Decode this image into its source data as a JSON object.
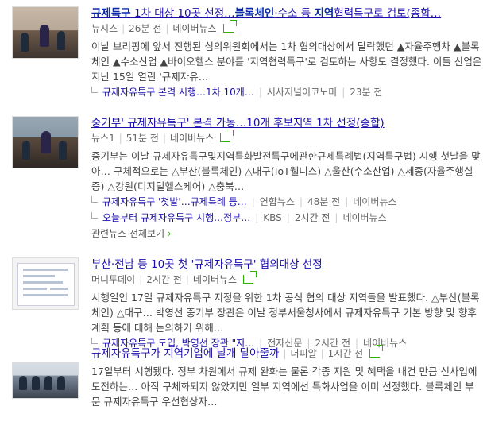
{
  "news": [
    {
      "title": "규제특구 1차 대상 10곳 선정…블록체인·수소 등 지역협력특구로 검토(종합…",
      "title_bold": [
        "규제특구",
        "블록체인",
        "지역"
      ],
      "meta": {
        "press": "뉴시스",
        "time": "26분 전",
        "portal": "네이버뉴스"
      },
      "desc": "이날 브리핑에 앞서 진행된 심의위원회에서는 1차 협의대상에서 탈락했던 ▲자율주행차 ▲블록체인 ▲수소산업 ▲바이오헬스 분야를 '지역협력특구'로 검토하는 사항도 결정했다. 이들 산업은 지난 15일 열린 '규제자유…",
      "related": [
        {
          "text": "규제자유특구 본격 시행…1차 10개…",
          "press": "시사저널이코노미",
          "time": "23분 전",
          "portal": ""
        }
      ]
    },
    {
      "title": "중기부' 규제자유특구' 본격 가동…10개 후보지역 1차 선정(종합)",
      "meta": {
        "press": "뉴스1",
        "time": "51분 전",
        "portal": "네이버뉴스"
      },
      "desc": "중기부는 이날 규제자유특구및지역특화발전특구에관한규제특례법(지역특구법) 시행 첫날을 맞아… 구체적으로는 △부산(블록체인) △대구(IoT웰니스) △울산(수소산업) △세종(자율주행실증) △강원(디지털헬스케어) △충북…",
      "related": [
        {
          "text": "규제자유특구 '첫발'…규제특례 등…",
          "press": "연합뉴스",
          "time": "48분 전",
          "portal": "네이버뉴스"
        },
        {
          "text": "오늘부터 규제자유특구 시행…정부…",
          "press": "KBS",
          "time": "2시간 전",
          "portal": "네이버뉴스"
        }
      ],
      "more": "관련뉴스 전체보기"
    },
    {
      "title": "부산·전남 등 10곳 첫 '규제자유특구' 협의대상 선정",
      "meta": {
        "press": "머니투데이",
        "time": "2시간 전",
        "portal": "네이버뉴스"
      },
      "desc": "시행일인 17일 규제자유특구 지정을 위한 1차 공식 협의 대상 지역들을 발표했다. △부산(블록체인) △대구… 박영선 중기부 장관은 이날 정부서울청사에서 규제자유특구 기본 방향 및 향후 계획 등에 대해 논의하기 위해…",
      "related": [
        {
          "text": "규제자유특구 도입, 박영선 장관 \"지…",
          "press": "전자신문",
          "time": "2시간 전",
          "portal": "네이버뉴스"
        }
      ]
    },
    {
      "title": "규제자유특구가 지역기업에 날개 달아줄까",
      "meta": {
        "press": "더피알",
        "time": "1시간 전",
        "portal": ""
      },
      "desc": "17일부터 시행됐다. 정부 차원에서 규제 완화는 물론 각종 지원 및 혜택을 내건 만큼 신사업에 도전하는… 아직 구체화되지 않았지만 일부 지역에선 특화사업을 이미 선정했다. 블록체인 부문 규제자유특구 우선협상자…"
    }
  ],
  "colors": {
    "link": "#1a0dab",
    "share": "#2db400"
  }
}
